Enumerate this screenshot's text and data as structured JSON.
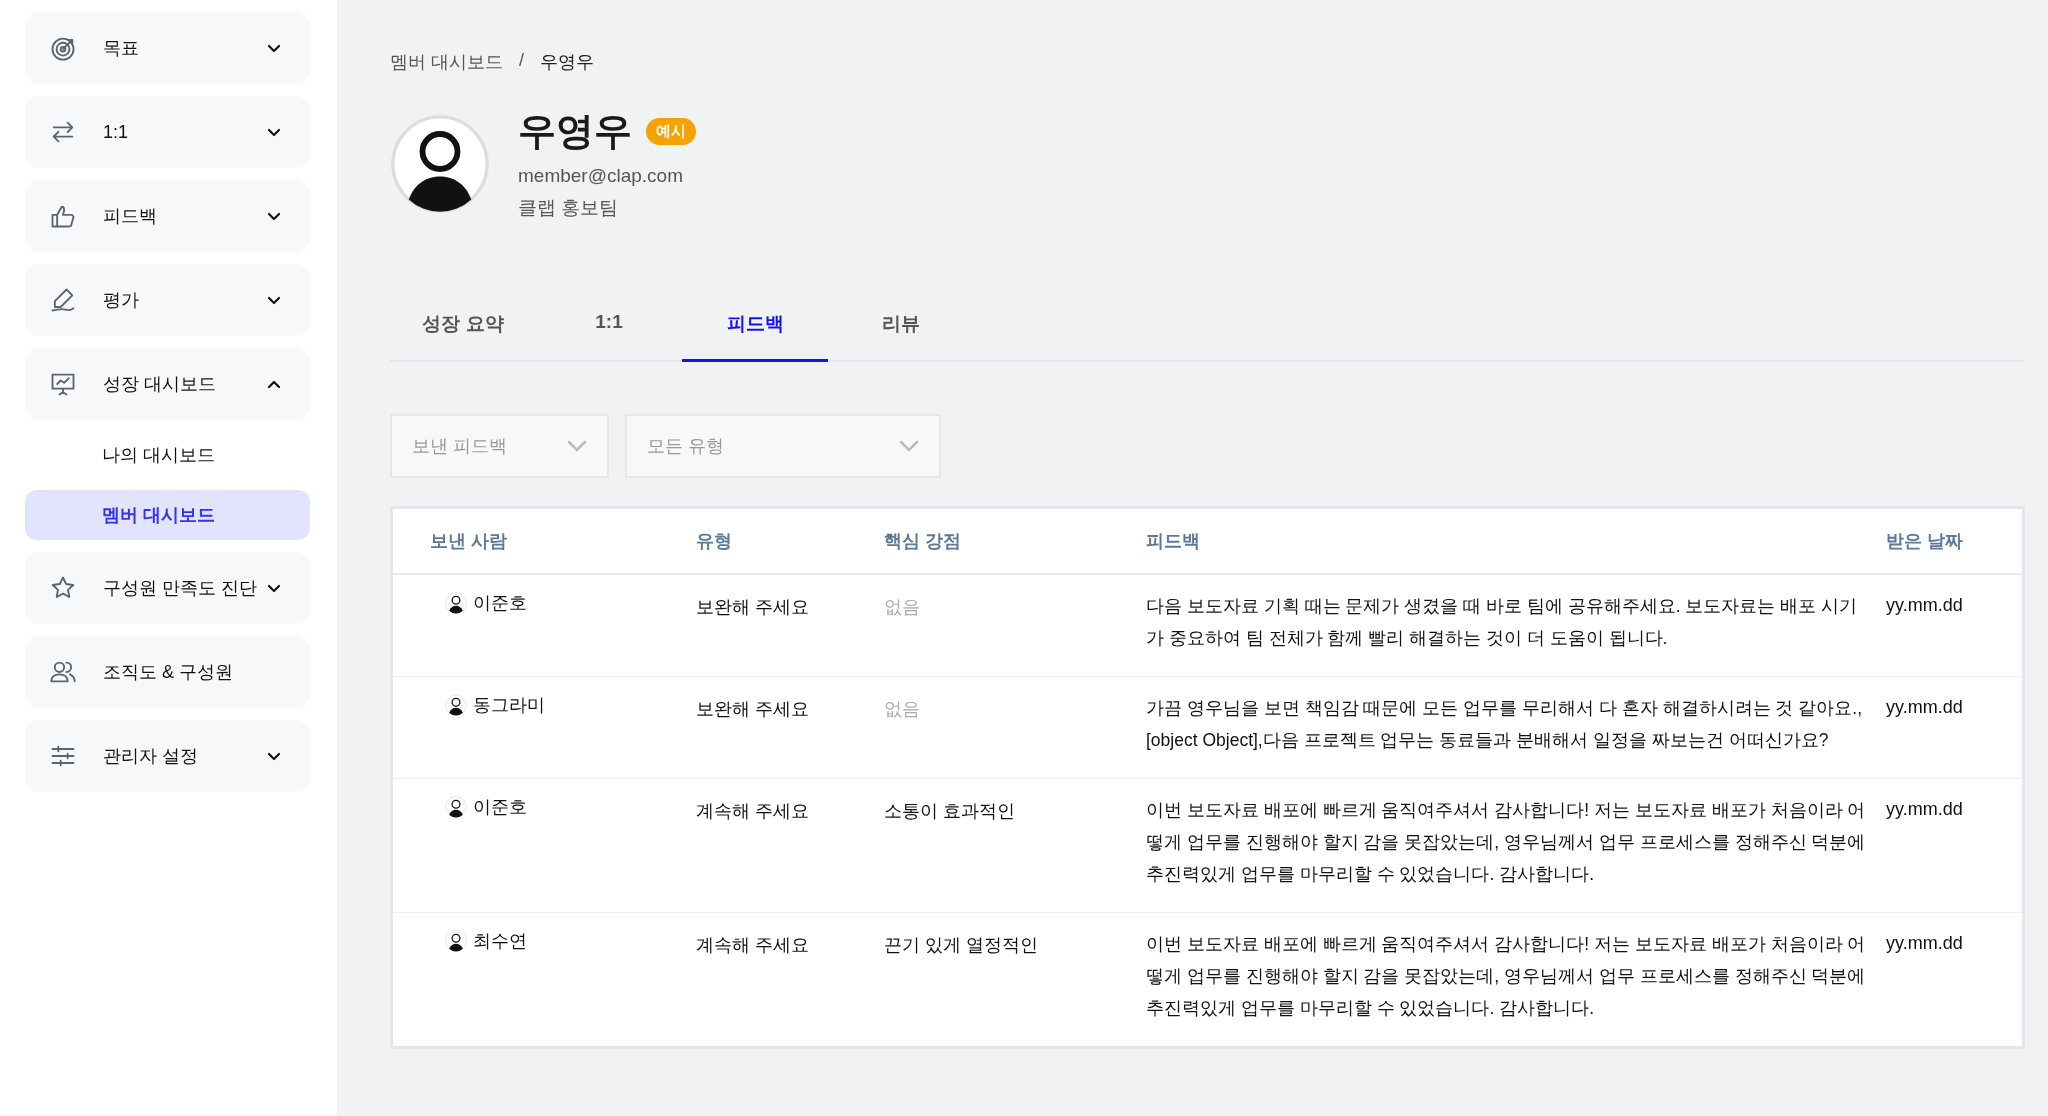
{
  "sidebar": {
    "items": [
      {
        "label": "목표",
        "kind": "menu",
        "expanded": false
      },
      {
        "label": "1:1",
        "kind": "menu",
        "expanded": false
      },
      {
        "label": "피드백",
        "kind": "menu",
        "expanded": false
      },
      {
        "label": "평가",
        "kind": "menu",
        "expanded": false
      },
      {
        "label": "성장 대시보드",
        "kind": "menu",
        "expanded": true,
        "children": [
          {
            "label": "나의 대시보드",
            "selected": false
          },
          {
            "label": "멤버 대시보드",
            "selected": true
          }
        ]
      },
      {
        "label": "구성원 만족도 진단",
        "kind": "menu",
        "expanded": false
      },
      {
        "label": "조직도 & 구성원",
        "kind": "link",
        "expanded": false
      },
      {
        "label": "관리자 설정",
        "kind": "menu",
        "expanded": false
      }
    ]
  },
  "breadcrumb": [
    "멤버 대시보드",
    "/",
    "우영우"
  ],
  "profile": {
    "name": "우영우",
    "badge": "예시",
    "email": "member@clap.com",
    "team": "클랩 홍보팀"
  },
  "tabs": [
    {
      "label": "성장 요약",
      "selected": false
    },
    {
      "label": "1:1",
      "selected": false
    },
    {
      "label": "피드백",
      "selected": true
    },
    {
      "label": "리뷰",
      "selected": false
    }
  ],
  "filters": [
    {
      "value": "보낸 피드백"
    },
    {
      "value": "모든 유형"
    }
  ],
  "table": {
    "columns": [
      "보낸 사람",
      "유형",
      "핵심 강점",
      "피드백",
      "받은 날짜"
    ],
    "rows": [
      {
        "sender": "이준호",
        "type": "보완해 주세요",
        "strength": "없음",
        "strength_empty": true,
        "feedback": "다음 보도자료 기획 때는 문제가 생겼을 때 바로 팀에 공유해주세요. 보도자료는 배포 시기가 중요하여 팀 전체가 함께 빨리 해결하는 것이 더 도움이 됩니다.",
        "date": "yy.mm.dd"
      },
      {
        "sender": "동그라미",
        "type": "보완해 주세요",
        "strength": "없음",
        "strength_empty": true,
        "feedback": "가끔 영우님을 보면 책임감 때문에 모든 업무를 무리해서 다 혼자 해결하시려는 것 같아요., [object Object],다음 프로젝트 업무는 동료들과 분배해서 일정을 짜보는건 어떠신가요?",
        "date": "yy.mm.dd"
      },
      {
        "sender": "이준호",
        "type": "계속해 주세요",
        "strength": "소통이 효과적인",
        "strength_empty": false,
        "feedback": "이번 보도자료 배포에 빠르게 움직여주셔서 감사합니다! 저는 보도자료 배포가 처음이라 어떻게 업무를 진행해야 할지 감을 못잡았는데, 영우님께서 업무 프로세스를 정해주신 덕분에 추진력있게 업무를 마무리할 수 있었습니다. 감사합니다.",
        "date": "yy.mm.dd"
      },
      {
        "sender": "최수연",
        "type": "계속해 주세요",
        "strength": "끈기 있게 열정적인",
        "strength_empty": false,
        "feedback": "이번 보도자료 배포에 빠르게 움직여주셔서 감사합니다! 저는 보도자료 배포가 처음이라 어떻게 업무를 진행해야 할지 감을 못잡았는데, 영우님께서 업무 프로세스를 정해주신 덕분에 추진력있게 업무를 마무리할 수 있었습니다. 감사합니다.",
        "date": "yy.mm.dd"
      }
    ]
  }
}
